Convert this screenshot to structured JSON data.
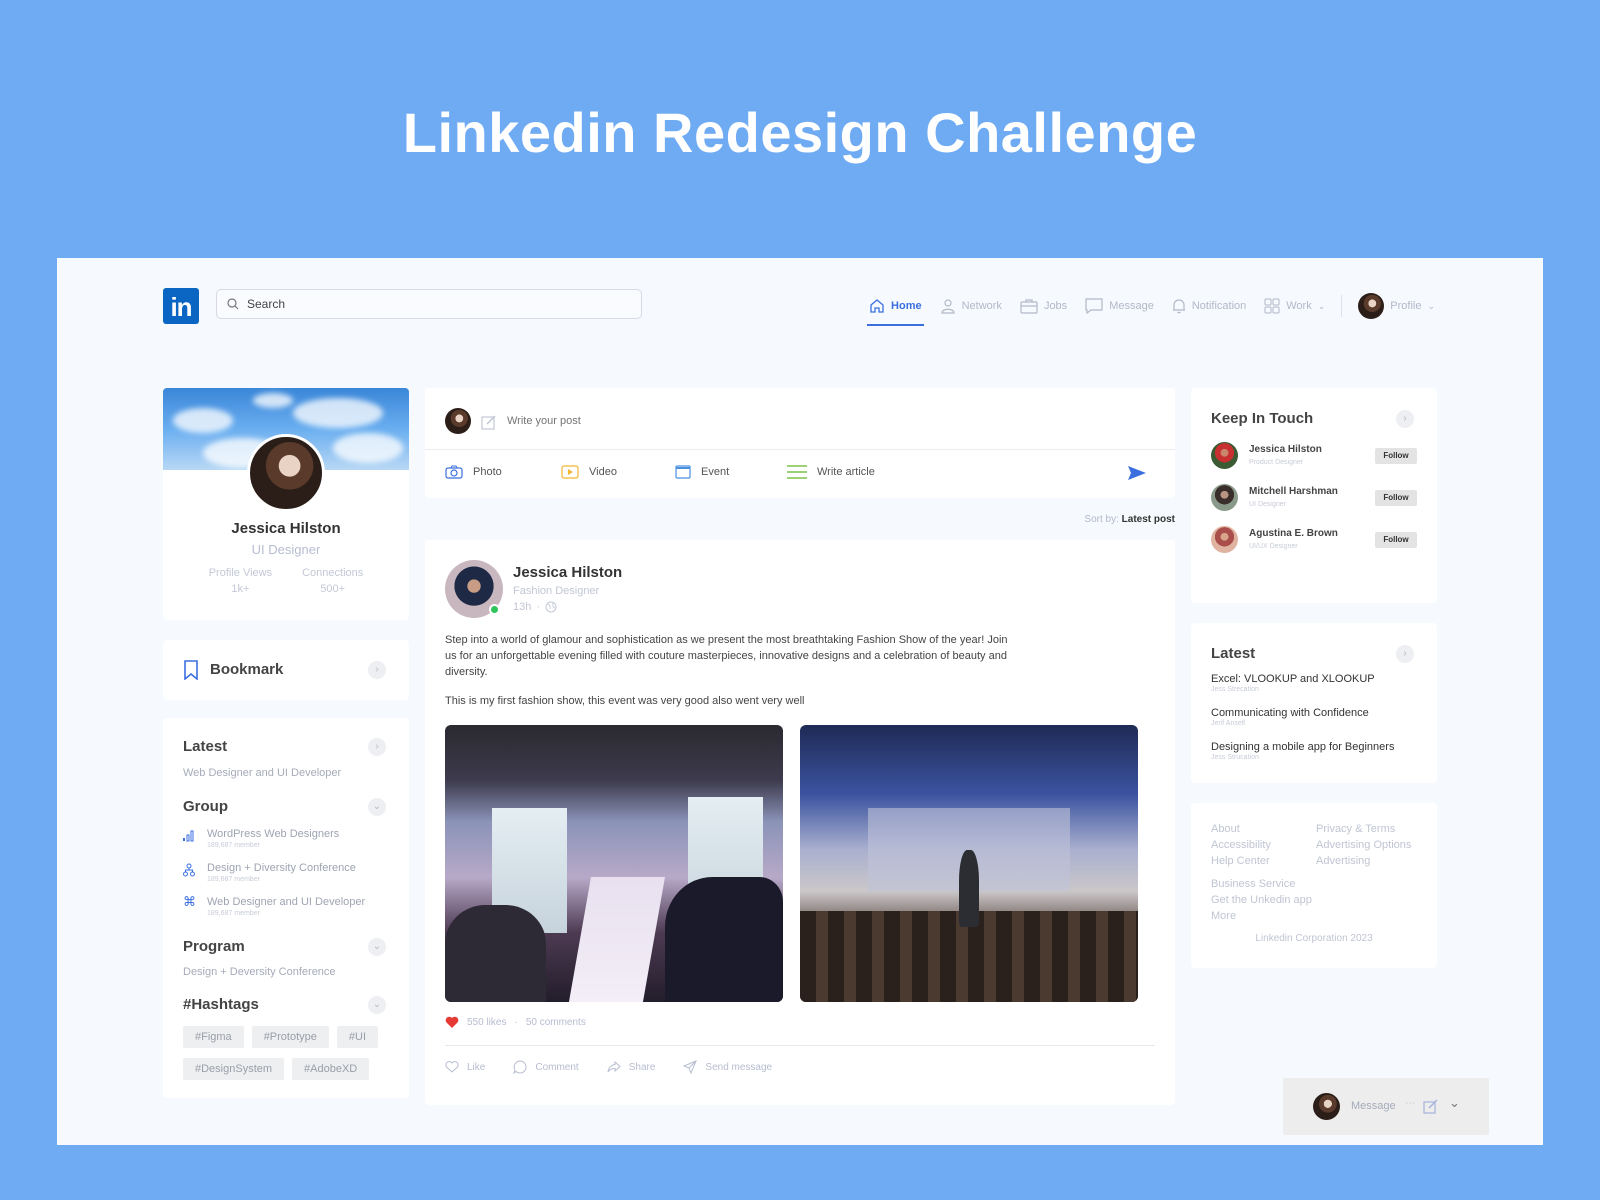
{
  "headline": "Linkedin Redesign Challenge",
  "topbar": {
    "logo": "in",
    "search_placeholder": "Search",
    "nav": [
      {
        "label": "Home",
        "icon": "home-icon",
        "active": true
      },
      {
        "label": "Network",
        "icon": "user-icon"
      },
      {
        "label": "Jobs",
        "icon": "briefcase-icon"
      },
      {
        "label": "Message",
        "icon": "message-icon"
      },
      {
        "label": "Notification",
        "icon": "bell-icon"
      },
      {
        "label": "Work",
        "icon": "grid-icon"
      }
    ],
    "profile_label": "Profile"
  },
  "profile": {
    "name": "Jessica Hilston",
    "title": "UI Designer",
    "stats": [
      {
        "label": "Profile Views",
        "value": "1k+"
      },
      {
        "label": "Connections",
        "value": "500+"
      }
    ]
  },
  "bookmark": {
    "label": "Bookmark"
  },
  "left": {
    "latest_title": "Latest",
    "latest_item": "Web Designer and UI Developer",
    "group_title": "Group",
    "groups": [
      {
        "name": "WordPress Web Designers",
        "members": "189,687 member",
        "icon": "bar-chart-icon"
      },
      {
        "name": "Design + Diversity Conference",
        "members": "189,687 member",
        "icon": "org-chart-icon"
      },
      {
        "name": "Web Designer and UI Developer",
        "members": "189,687 member",
        "icon": "command-icon"
      }
    ],
    "program_title": "Program",
    "program_item": "Design + Deversity Conference",
    "hashtags_title": "#Hashtags",
    "hashtags": [
      "#Figma",
      "#Prototype",
      "#UI",
      "#DesignSystem",
      "#AdobeXD"
    ]
  },
  "composer": {
    "placeholder": "Write your post",
    "tools": [
      {
        "label": "Photo",
        "icon": "camera-icon",
        "color": "#3b6fe0"
      },
      {
        "label": "Video",
        "icon": "video-icon",
        "color": "#f2b632"
      },
      {
        "label": "Event",
        "icon": "calendar-icon",
        "color": "#4a8fe0"
      },
      {
        "label": "Write article",
        "icon": "article-icon",
        "color": "#7cc24a"
      }
    ]
  },
  "sort": {
    "label": "Sort by:",
    "value": "Latest post"
  },
  "post": {
    "author": "Jessica Hilston",
    "role": "Fashion Designer",
    "time": "13h",
    "body1": "Step into a world of glamour and sophistication as we present the most breathtaking Fashion Show of the year! Join us for an unforgettable evening filled with couture masterpieces, innovative designs and a celebration of beauty and diversity.",
    "body2": "This is my first fashion show, this event was very good also went very well",
    "likes": "550 likes",
    "comments": "50 comments",
    "actions": [
      {
        "label": "Like",
        "icon": "heart-outline-icon"
      },
      {
        "label": "Comment",
        "icon": "comment-icon"
      },
      {
        "label": "Share",
        "icon": "share-icon"
      },
      {
        "label": "Send message",
        "icon": "send-icon"
      }
    ]
  },
  "keep_in_touch": {
    "title": "Keep In Touch",
    "people": [
      {
        "name": "Jessica Hilston",
        "role": "Product Designer",
        "button": "Follow"
      },
      {
        "name": "Mitchell Harshman",
        "role": "UI Designer",
        "button": "Follow"
      },
      {
        "name": "Agustina E. Brown",
        "role": "UI/UX Designer",
        "button": "Follow"
      }
    ]
  },
  "latest_right": {
    "title": "Latest",
    "items": [
      {
        "title": "Excel: VLOOKUP and XLOOKUP",
        "author": "Jess Strecation"
      },
      {
        "title": "Communicating with Confidence",
        "author": "Jerif Anself"
      },
      {
        "title": "Designing a mobile app for Beginners",
        "author": "Jess Strucation"
      }
    ]
  },
  "footer": {
    "col1": [
      "About",
      "Accessibility",
      "Help Center"
    ],
    "col2": [
      "Privacy & Terms",
      "Advertising Options",
      "Advertising"
    ],
    "col3": [
      "Business Service",
      "Get the Unkedin app",
      "More"
    ],
    "copyright": "Linkedin Corporation 2023"
  },
  "message_bar": {
    "label": "Message"
  }
}
